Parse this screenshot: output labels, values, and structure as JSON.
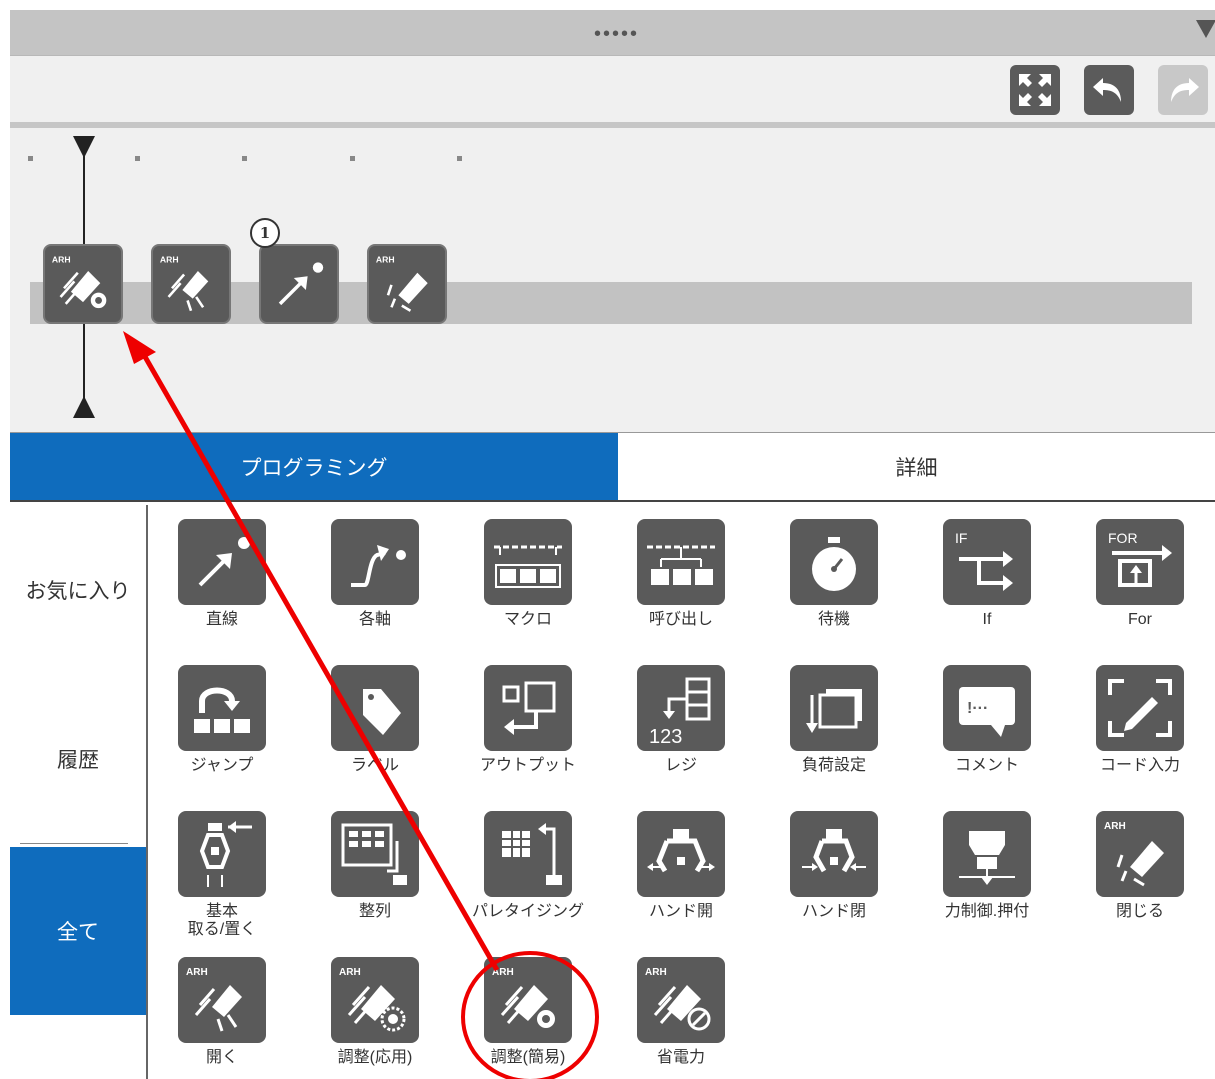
{
  "window": {
    "drag_handle": "•••••"
  },
  "toolbar": {
    "buttons": [
      {
        "name": "fullscreen-icon"
      },
      {
        "name": "undo-icon"
      },
      {
        "name": "redo-icon",
        "disabled": true
      }
    ]
  },
  "timeline": {
    "badge": "1",
    "commands": [
      "arh-adjust-simple-icon",
      "arh-open-icon",
      "linear-move-icon",
      "arh-close-icon"
    ]
  },
  "tabs": [
    {
      "label": "プログラミング",
      "active": true
    },
    {
      "label": "詳細",
      "active": false
    }
  ],
  "sidebar": {
    "items": [
      {
        "label": "お気に入り"
      },
      {
        "label": "履歴"
      },
      {
        "label": "全て",
        "active": true
      }
    ]
  },
  "palette": {
    "rows": [
      [
        {
          "label": "直線",
          "icon": "linear-move-icon"
        },
        {
          "label": "各軸",
          "icon": "joint-move-icon"
        },
        {
          "label": "マクロ",
          "icon": "macro-icon"
        },
        {
          "label": "呼び出し",
          "icon": "call-icon"
        },
        {
          "label": "待機",
          "icon": "stopwatch-icon"
        },
        {
          "label": "If",
          "icon": "if-icon"
        },
        {
          "label": "For",
          "icon": "for-icon"
        }
      ],
      [
        {
          "label": "ジャンプ",
          "icon": "jump-icon"
        },
        {
          "label": "ラベル",
          "icon": "label-tag-icon"
        },
        {
          "label": "アウトプット",
          "icon": "output-icon"
        },
        {
          "label": "レジ",
          "icon": "register-icon"
        },
        {
          "label": "負荷設定",
          "icon": "payload-icon"
        },
        {
          "label": "コメント",
          "icon": "comment-icon"
        },
        {
          "label": "コード入力",
          "icon": "code-input-icon"
        }
      ],
      [
        {
          "label": "基本\n取る/置く",
          "icon": "pick-place-icon"
        },
        {
          "label": "整列",
          "icon": "align-icon"
        },
        {
          "label": "パレタイジング",
          "icon": "palletizing-icon"
        },
        {
          "label": "ハンド開",
          "icon": "hand-open-icon"
        },
        {
          "label": "ハンド閉",
          "icon": "hand-close-icon"
        },
        {
          "label": "力制御.押付",
          "icon": "force-push-icon"
        },
        {
          "label": "閉じる",
          "icon": "arh-close-icon"
        }
      ],
      [
        {
          "label": "開く",
          "icon": "arh-open-icon"
        },
        {
          "label": "調整(応用)",
          "icon": "arh-adjust-advanced-icon"
        },
        {
          "label": "調整(簡易)",
          "icon": "arh-adjust-simple-icon"
        },
        {
          "label": "省電力",
          "icon": "arh-power-save-icon"
        }
      ]
    ]
  },
  "annotation": {
    "color": "#ee0000"
  }
}
